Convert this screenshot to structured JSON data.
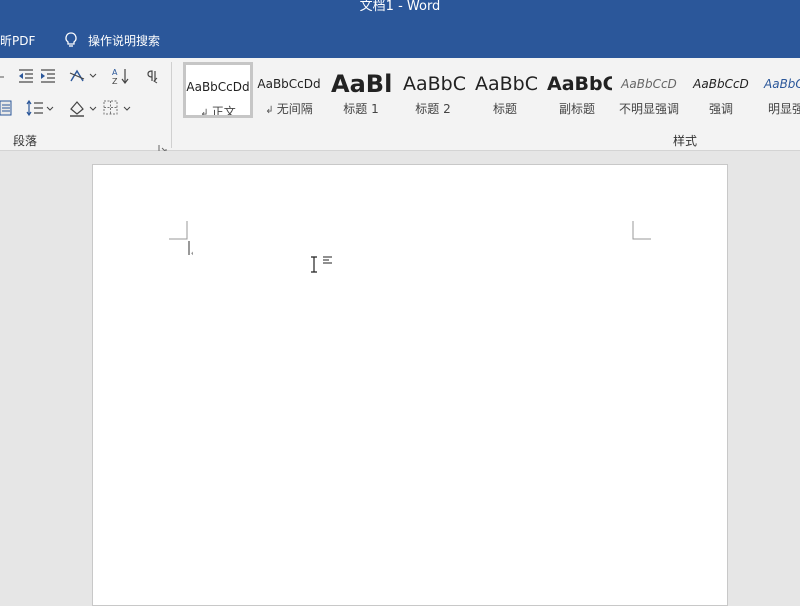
{
  "window": {
    "title": "文档1  -  Word"
  },
  "tabs": {
    "pdf_tab": "福昕PDF",
    "tell_me": "操作说明搜索"
  },
  "ribbon": {
    "paragraph_group_label": "段落",
    "styles_group_label": "样式",
    "styles": [
      {
        "sample": "AaBbCcDd",
        "name": "正文",
        "selected": true
      },
      {
        "sample": "AaBbCcDd",
        "name": "无间隔"
      },
      {
        "sample": "AaBl",
        "name": "标题 1"
      },
      {
        "sample": "AaBbC",
        "name": "标题 2"
      },
      {
        "sample": "AaBbC",
        "name": "标题"
      },
      {
        "sample": "AaBbC",
        "name": "副标题"
      },
      {
        "sample": "AaBbCcD",
        "name": "不明显强调"
      },
      {
        "sample": "AaBbCcD",
        "name": "强调"
      },
      {
        "sample": "AaBbC",
        "name": "明显强"
      }
    ]
  },
  "colors": {
    "titlebar": "#2b579a",
    "ribbon_bg": "#f3f3f3",
    "doc_bg": "#e6e6e6",
    "page_bg": "#ffffff"
  }
}
